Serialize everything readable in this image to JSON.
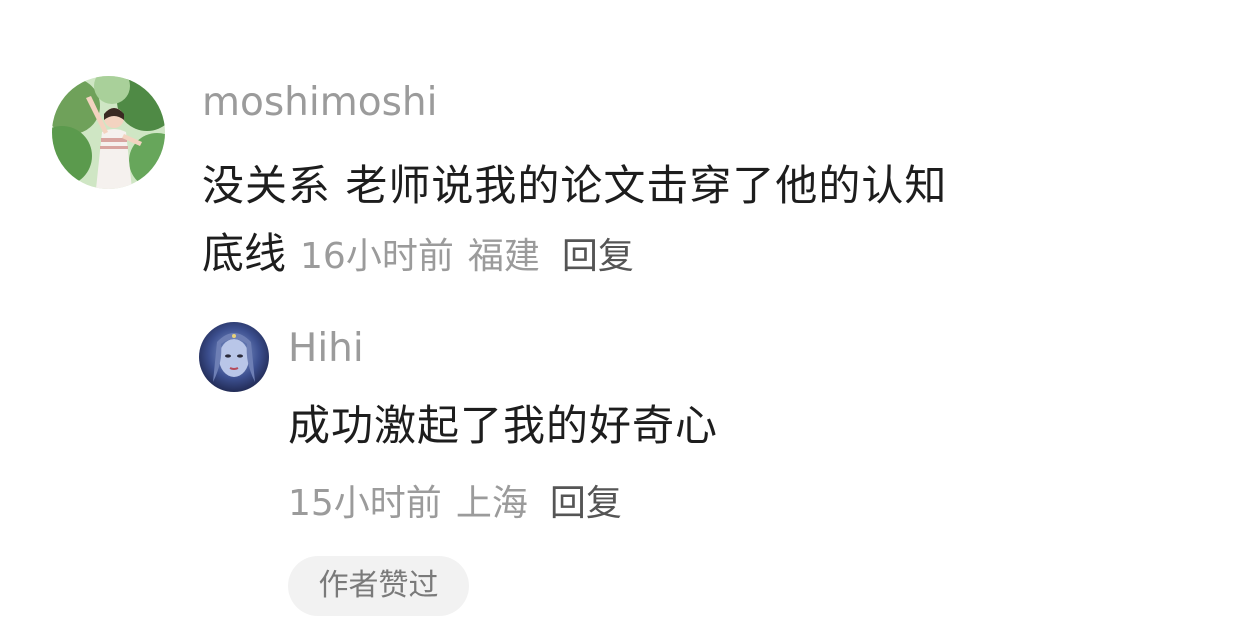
{
  "comment": {
    "author": "moshimoshi",
    "content_line1": "没关系 老师说我的论文击穿了他的认知",
    "content_line2": "底线",
    "time": "16小时前",
    "location": "福建",
    "reply_label": "回复"
  },
  "reply": {
    "author": "Hihi",
    "content": "成功激起了我的好奇心",
    "time": "15小时前",
    "location": "上海",
    "reply_label": "回复",
    "badge": "作者赞过"
  }
}
